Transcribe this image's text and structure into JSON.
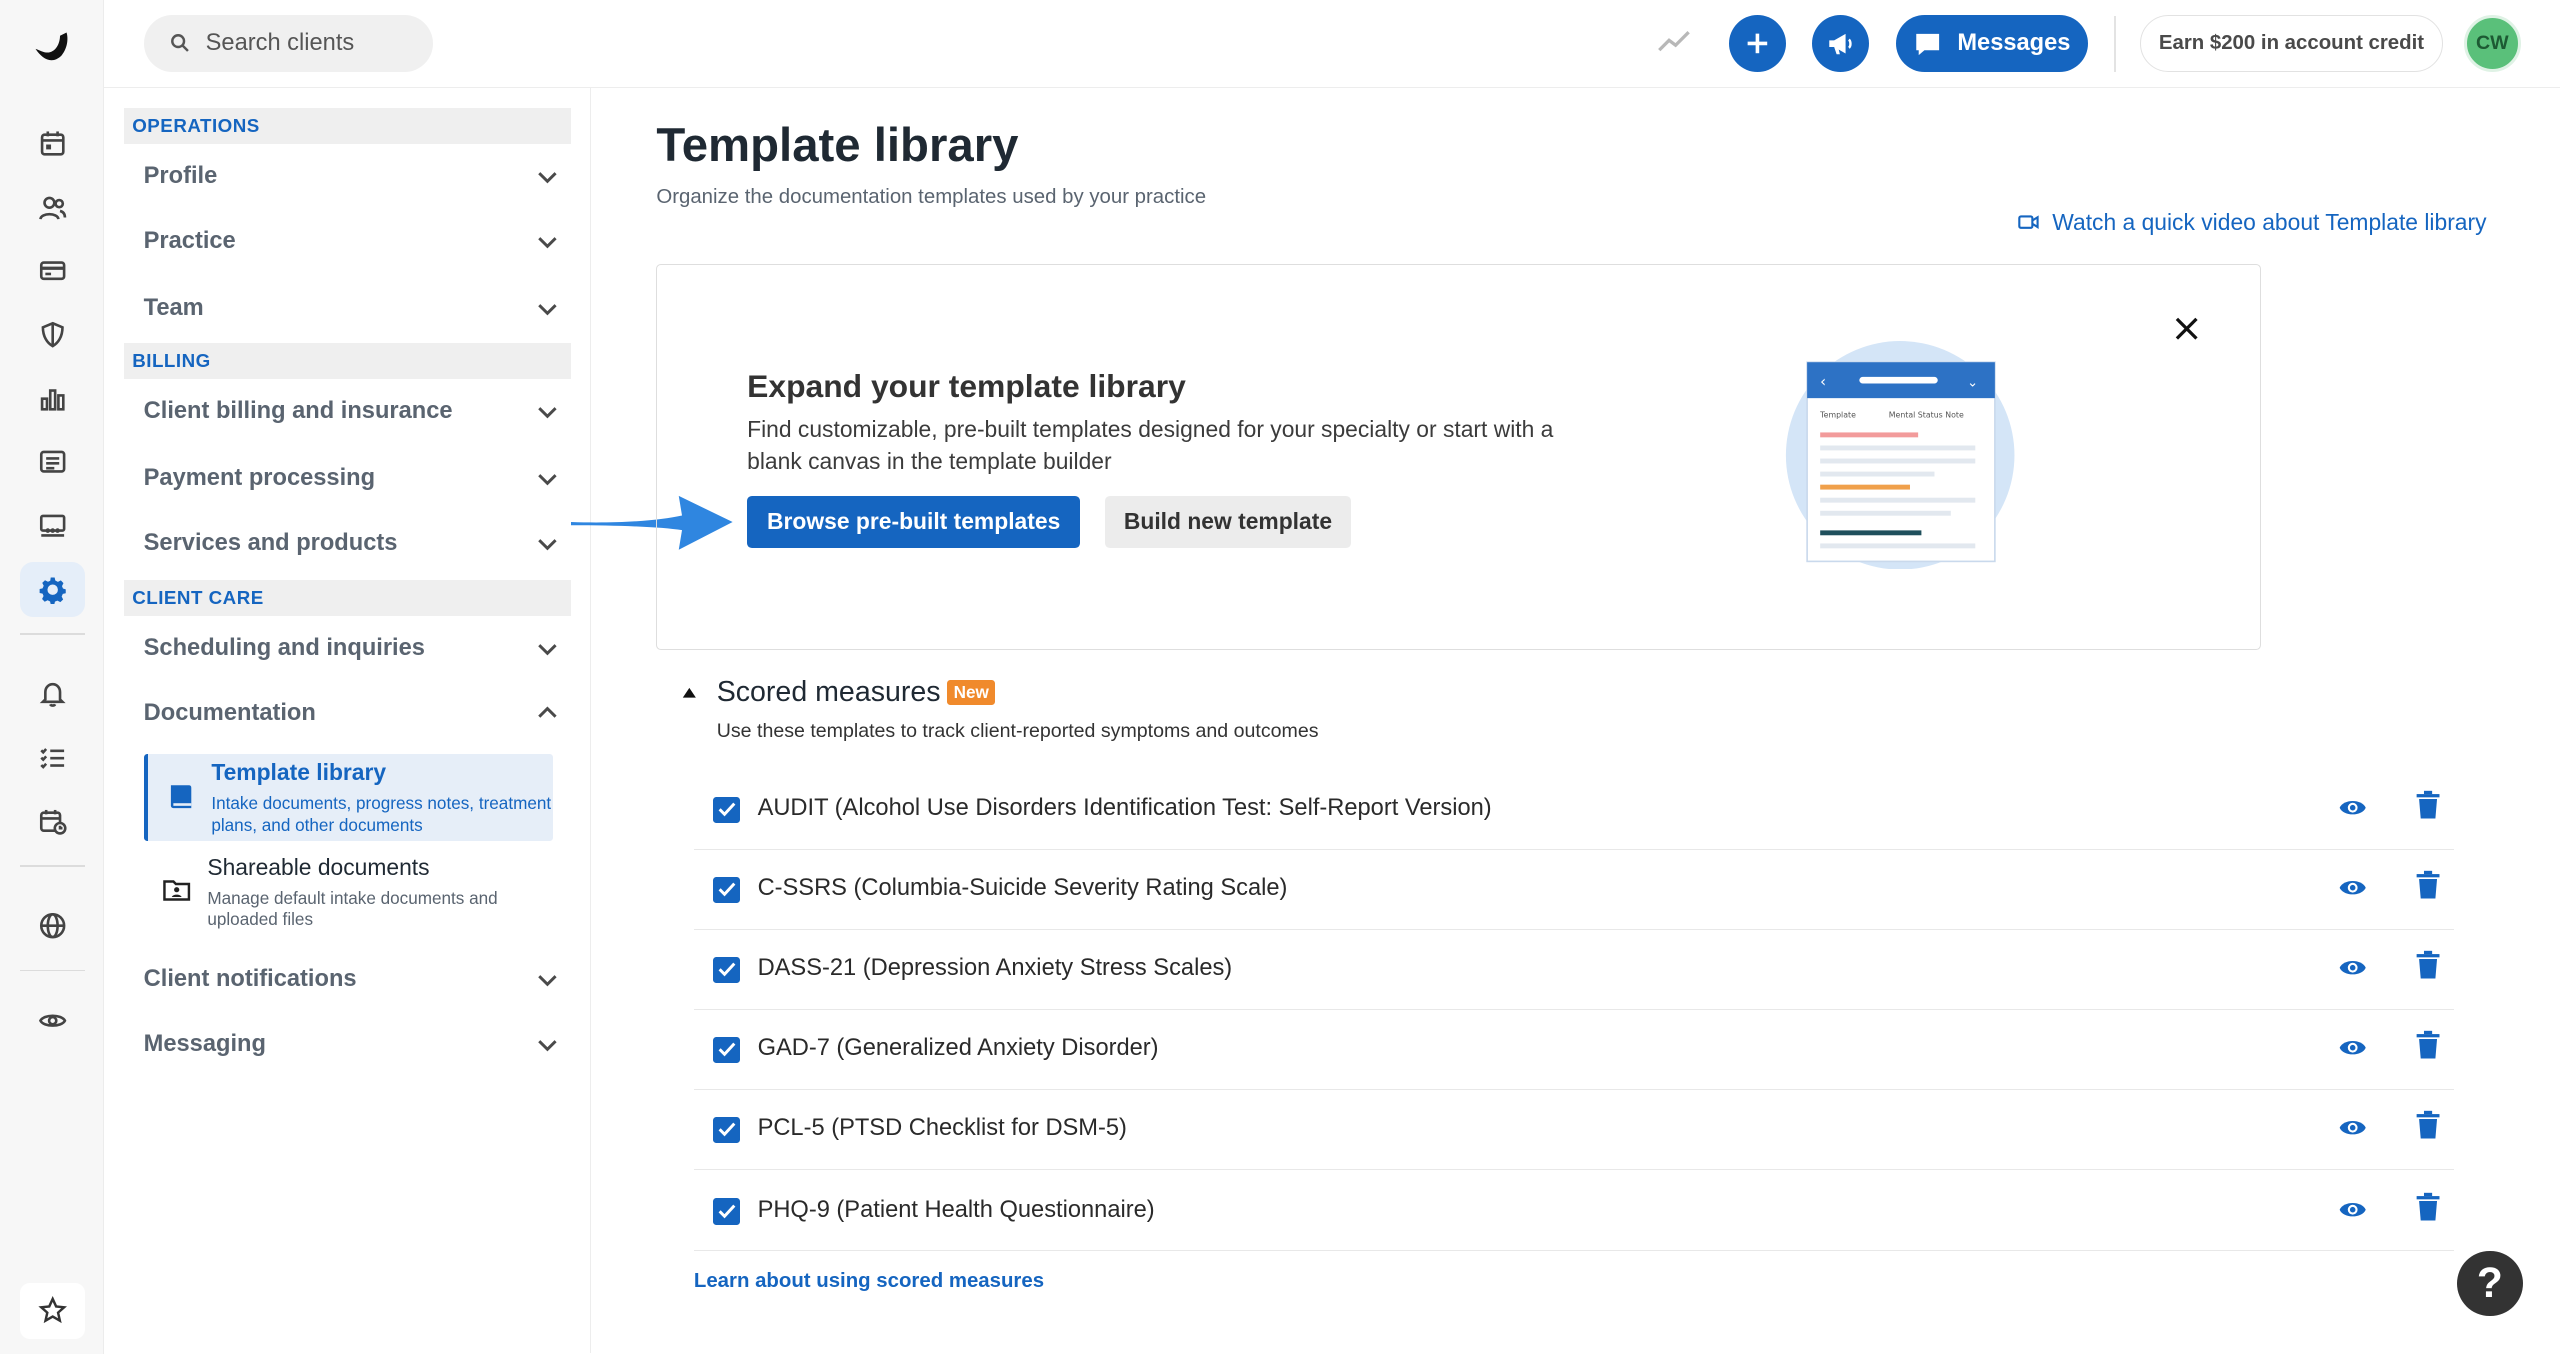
{
  "topbar": {
    "search_placeholder": "Search clients",
    "messages_label": "Messages",
    "credit_label": "Earn $200 in account credit",
    "avatar_initials": "CW"
  },
  "sidebar": {
    "sections": [
      {
        "label": "OPERATIONS",
        "items": [
          "Profile",
          "Practice",
          "Team"
        ]
      },
      {
        "label": "BILLING",
        "items": [
          "Client billing and insurance",
          "Payment processing",
          "Services and products"
        ]
      },
      {
        "label": "CLIENT CARE",
        "items": [
          "Scheduling and inquiries",
          "Documentation",
          "Client notifications",
          "Messaging"
        ]
      }
    ],
    "documentation_sub": [
      {
        "title": "Template library",
        "desc": "Intake documents, progress notes, treatment plans, and other documents",
        "active": true
      },
      {
        "title": "Shareable documents",
        "desc": "Manage default intake documents and uploaded files",
        "active": false
      }
    ]
  },
  "main": {
    "title": "Template library",
    "subtitle": "Organize the documentation templates used by your practice",
    "video_link": "Watch a quick video about Template library",
    "promo": {
      "heading": "Expand your template library",
      "body": "Find customizable, pre-built templates designed for your specialty or start with a blank canvas in the template builder",
      "primary_button": "Browse pre-built templates",
      "secondary_button": "Build new template",
      "illustration": {
        "col1": "Template",
        "col2": "Mental Status Note"
      }
    },
    "scored_measures": {
      "heading": "Scored measures",
      "badge": "New",
      "description": "Use these templates to track client-reported symptoms and outcomes",
      "items": [
        "AUDIT (Alcohol Use Disorders Identification Test: Self-Report Version)",
        "C-SSRS (Columbia-Suicide Severity Rating Scale)",
        "DASS-21 (Depression Anxiety Stress Scales)",
        "GAD-7 (Generalized Anxiety Disorder)",
        "PCL-5 (PTSD Checklist for DSM-5)",
        "PHQ-9 (Patient Health Questionnaire)"
      ],
      "learn_link": "Learn about using scored measures"
    },
    "help_label": "?"
  },
  "colors": {
    "accent": "#1565c0",
    "badge": "#f08a2c",
    "avatar": "#5ac07a"
  }
}
